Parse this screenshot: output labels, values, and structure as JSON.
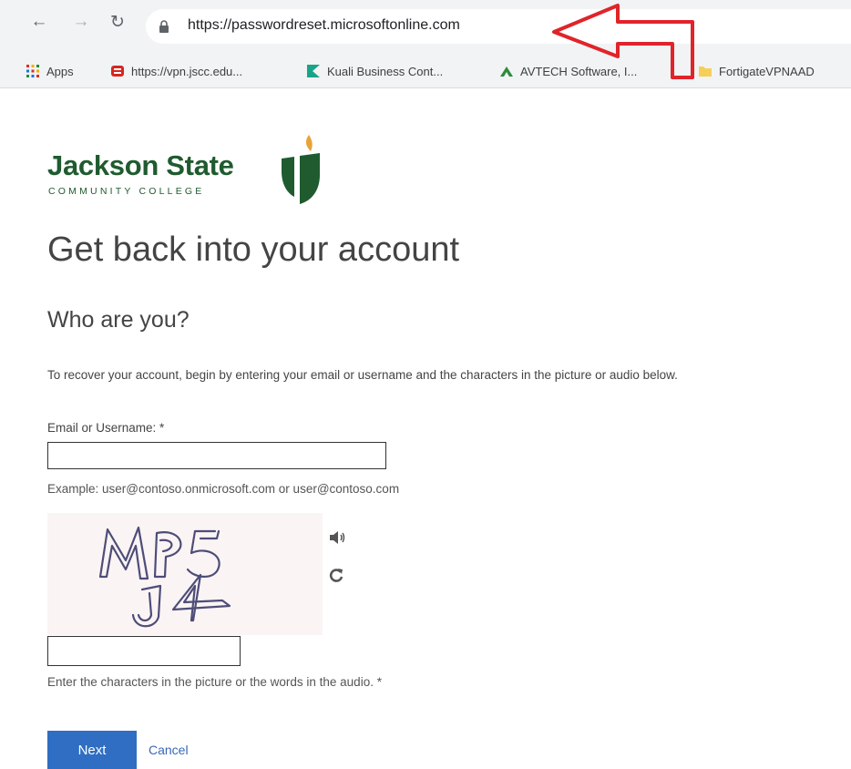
{
  "browser": {
    "url": "https://passwordreset.microsoftonline.com",
    "bookmarks": [
      {
        "label": "Apps",
        "icon": "apps-grid-icon"
      },
      {
        "label": "https://vpn.jscc.edu...",
        "icon": "vpn-favicon"
      },
      {
        "label": "Kuali Business Cont...",
        "icon": "kuali-favicon"
      },
      {
        "label": "AVTECH Software, I...",
        "icon": "avtech-favicon"
      },
      {
        "label": "FortigateVPNAAD",
        "icon": "folder-icon"
      }
    ],
    "annotation_color": "#e0242a"
  },
  "logo": {
    "name": "Jackson State",
    "subtitle": "COMMUNITY COLLEGE",
    "brand_color": "#1f5b2f"
  },
  "page": {
    "title": "Get back into your account",
    "subtitle": "Who are you?",
    "intro": "To recover your account, begin by entering your email or username and the characters in the picture or audio below."
  },
  "form": {
    "email_label": "Email or Username: *",
    "email_value": "",
    "example": "Example: user@contoso.onmicrosoft.com or user@contoso.com",
    "captcha_text": "MP5 J4",
    "captcha_value": "",
    "captcha_hint": "Enter the characters in the picture or the words in the audio. *",
    "next_label": "Next",
    "cancel_label": "Cancel",
    "accent_color": "#2f6ec2"
  }
}
